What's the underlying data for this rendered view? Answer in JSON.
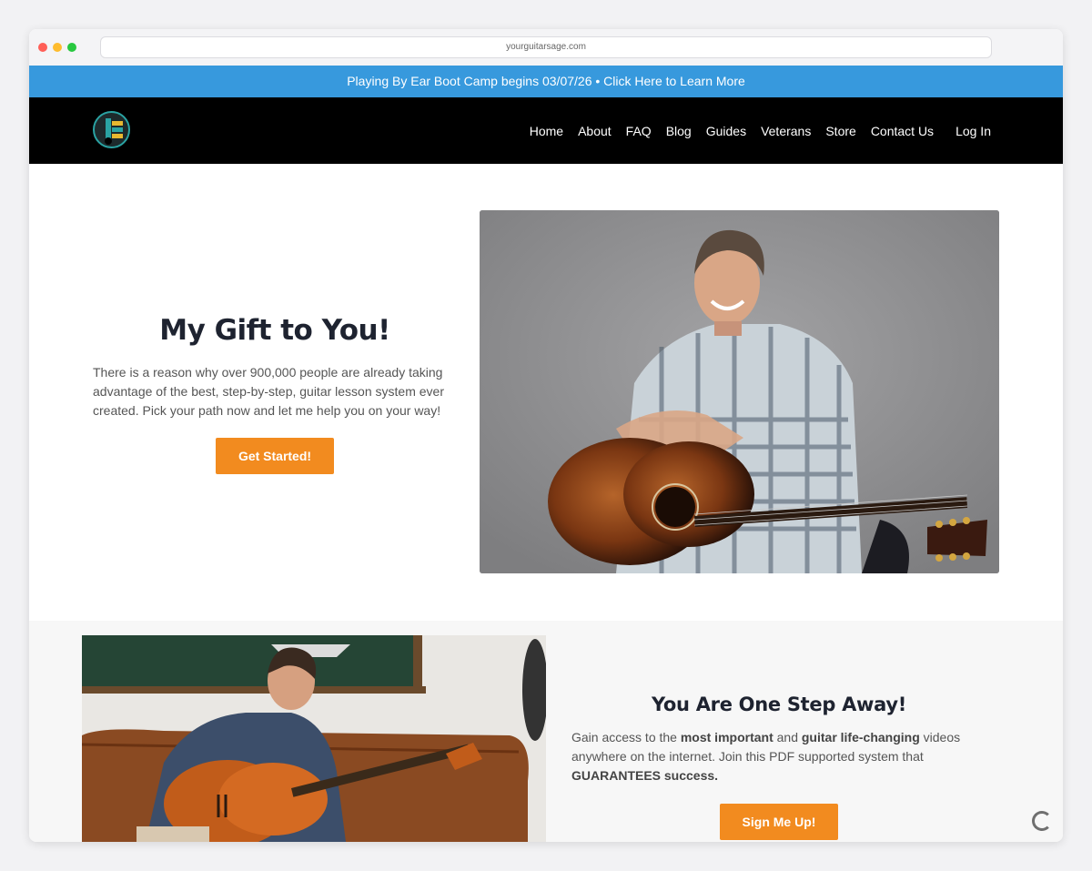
{
  "browser": {
    "url": "yourguitarsage.com"
  },
  "promo_banner": {
    "text": "Playing By Ear Boot Camp begins 03/07/26 • Click Here to Learn More"
  },
  "nav": {
    "items": [
      {
        "label": "Home"
      },
      {
        "label": "About"
      },
      {
        "label": "FAQ"
      },
      {
        "label": "Blog"
      },
      {
        "label": "Guides"
      },
      {
        "label": "Veterans"
      },
      {
        "label": "Store"
      },
      {
        "label": "Contact Us"
      }
    ],
    "login_label": "Log In"
  },
  "hero": {
    "title": "My Gift to You!",
    "body": "There is a reason why over 900,000 people are already taking advantage of the best, step-by-step, guitar lesson system ever created. Pick your path now and let me help you on your way!",
    "button_label": "Get Started!"
  },
  "section2": {
    "title": "You Are One Step Away!",
    "body_parts": {
      "p1": "Gain access to the ",
      "b1": "most important",
      "p2": " and ",
      "b2": "guitar life-changing",
      "p3": " videos anywhere on the internet. Join this PDF supported system that ",
      "b3": "GUARANTEES success."
    },
    "button_label": "Sign Me Up!"
  },
  "colors": {
    "banner": "#3799dd",
    "nav_bg": "#000000",
    "cta": "#f28b1f",
    "heading": "#1e2330"
  }
}
